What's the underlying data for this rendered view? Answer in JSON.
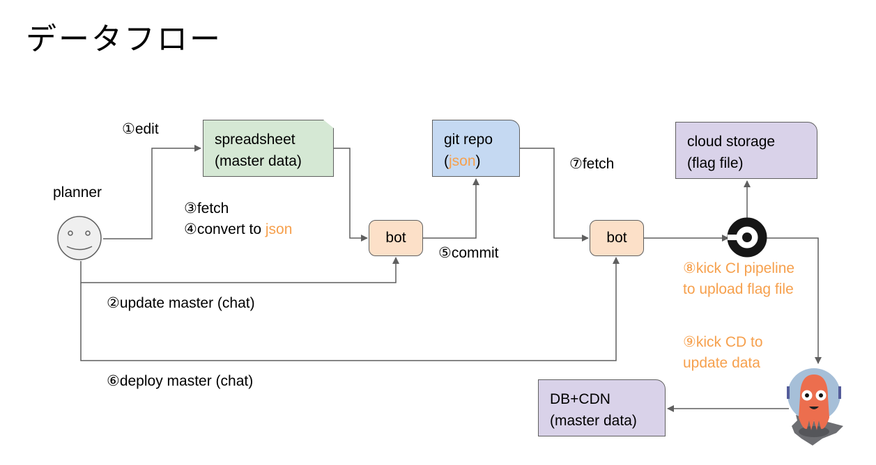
{
  "title": "データフロー",
  "colors": {
    "accent_orange": "#f6a04d",
    "spreadsheet_fill": "#d5e8d4",
    "git_fill": "#c5d9f2",
    "storage_fill": "#d9d2e9",
    "bot_fill": "#fce0c8",
    "line": "#5f5f5f"
  },
  "nodes": {
    "planner": {
      "label": "planner"
    },
    "spreadsheet": {
      "line1": "spreadsheet",
      "line2": "(master data)"
    },
    "bot1": {
      "label": "bot"
    },
    "git_repo": {
      "line1": "git repo",
      "line2_pre": "(",
      "line2_accent": "json",
      "line2_post": ")"
    },
    "bot2": {
      "label": "bot"
    },
    "cloud_storage": {
      "line1": "cloud storage",
      "line2": "(flag file)"
    },
    "ci": {
      "icon": "circleci-icon"
    },
    "cd": {
      "icon": "argo-octopus-icon"
    },
    "db_cdn": {
      "line1": "DB+CDN",
      "line2": "(master data)"
    }
  },
  "edges": {
    "edit": "①edit",
    "update": "②update master (chat)",
    "fetch3": "③fetch",
    "convert_pre": "④convert to ",
    "convert_accent": "json",
    "commit": "⑤commit",
    "deploy": "⑥deploy master (chat)",
    "fetch7": "⑦fetch",
    "kick_ci_1": "⑧kick CI pipeline",
    "kick_ci_2": "to upload flag file",
    "kick_cd_1": "⑨kick CD to",
    "kick_cd_2": "update data"
  }
}
